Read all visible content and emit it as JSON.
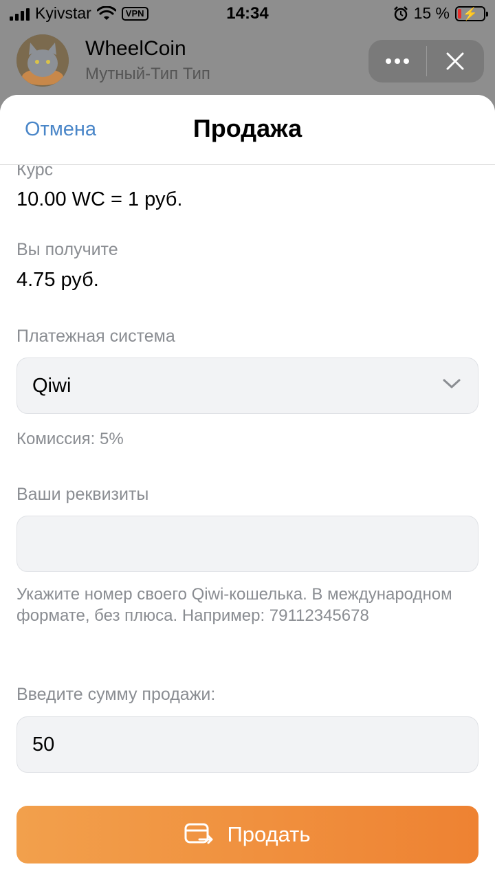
{
  "status_bar": {
    "carrier": "Kyivstar",
    "vpn": "VPN",
    "time": "14:34",
    "battery_percent": "15 %",
    "battery_level": 0.15,
    "battery_color": "#e8302c"
  },
  "app": {
    "title": "WheelCoin",
    "subtitle": "Мутный-Тип Тип"
  },
  "sheet": {
    "cancel_label": "Отмена",
    "title": "Продажа"
  },
  "rate": {
    "label": "Курс",
    "value": "10.00 WC = 1 руб."
  },
  "receive": {
    "label": "Вы получите",
    "value": "4.75 руб."
  },
  "payment": {
    "label": "Платежная система",
    "selected": "Qiwi",
    "commission": "Комиссия: 5%"
  },
  "details": {
    "label": "Ваши реквизиты",
    "value": "",
    "hint": "Укажите номер своего Qiwi-кошелька. В международном формате, без плюса. Например: 79112345678"
  },
  "amount": {
    "label": "Введите сумму продажи:",
    "value": "50"
  },
  "sell_button": {
    "label": "Продать",
    "icon": "card-transfer-icon"
  },
  "colors": {
    "accent_link": "#4a86c8",
    "button_start": "#f2a04c",
    "button_end": "#ee8232"
  }
}
